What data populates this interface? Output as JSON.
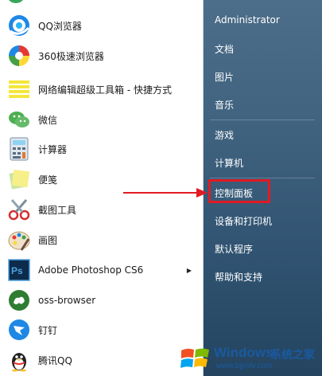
{
  "programs": [
    {
      "label": "QQ浏览器",
      "icon": "qq-browser-icon"
    },
    {
      "label": "360极速浏览器",
      "icon": "360-browser-icon"
    },
    {
      "label": "网络编辑超级工具箱 - 快捷方式",
      "icon": "toolbox-shortcut-icon"
    },
    {
      "label": "微信",
      "icon": "wechat-icon"
    },
    {
      "label": "计算器",
      "icon": "calculator-icon"
    },
    {
      "label": "便笺",
      "icon": "sticky-notes-icon"
    },
    {
      "label": "截图工具",
      "icon": "snipping-tool-icon"
    },
    {
      "label": "画图",
      "icon": "paint-icon"
    },
    {
      "label": "Adobe Photoshop CS6",
      "icon": "photoshop-icon",
      "submenu_glyph": "▶"
    },
    {
      "label": "oss-browser",
      "icon": "oss-browser-icon"
    },
    {
      "label": "钉钉",
      "icon": "dingtalk-icon"
    },
    {
      "label": "腾讯QQ",
      "icon": "qq-penguin-icon"
    }
  ],
  "right_panel": {
    "user": "Administrator",
    "items": [
      "文档",
      "图片",
      "音乐",
      "游戏",
      "计算机",
      "控制面板",
      "设备和打印机",
      "默认程序",
      "帮助和支持"
    ]
  },
  "annotation": {
    "highlight_color": "#e01b24",
    "highlighted_item": "控制面板"
  },
  "watermark": {
    "brand": "Windows",
    "cn": "系统之家",
    "url": "www.bjjmlv.com"
  },
  "colors": {
    "panel_top": "#4d6e8a",
    "panel_bottom": "#24445f",
    "accent_red": "#e01b24"
  }
}
